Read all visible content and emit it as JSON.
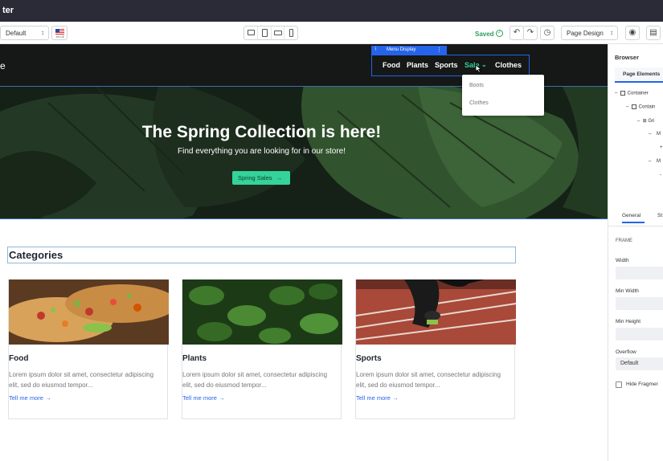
{
  "app": {
    "title_fragment": "ter"
  },
  "toolbar": {
    "segment_select": "Default",
    "language_label": "en-US",
    "saved_label": "Saved",
    "page_design_select": "Page Design"
  },
  "site": {
    "logo_fragment": "e",
    "menu_display_label": "Menu Display",
    "menu": [
      "Food",
      "Plants",
      "Sports",
      "Sale",
      "Clothes"
    ],
    "sale_color": "#34d399",
    "dropdown": [
      "Boots",
      "Clothes"
    ],
    "hero": {
      "title": "The Spring Collection is here!",
      "subtitle": "Find everything you are looking for in our store!",
      "button": "Spring Sales"
    },
    "categories_heading": "Categories",
    "cards": [
      {
        "title": "Food",
        "text": "Lorem ipsum dolor sit amet, consectetur adipiscing elit, sed do eiusmod tempor...",
        "link": "Tell me more"
      },
      {
        "title": "Plants",
        "text": "Lorem ipsum dolor sit amet, consectetur adipiscing elit, sed do eiusmod tempor...",
        "link": "Tell me more"
      },
      {
        "title": "Sports",
        "text": "Lorem ipsum dolor sit amet, consectetur adipiscing elit, sed do eiusmod tempor...",
        "link": "Tell me more"
      }
    ]
  },
  "panel": {
    "title": "Browser",
    "tab": "Page Elements",
    "tree": [
      "Container",
      "Contain",
      "Gri",
      "M",
      "+",
      "M",
      "-"
    ],
    "tabs": [
      "General",
      "St"
    ],
    "section": "FRAME",
    "fields": [
      "Width",
      "Min Width",
      "Min Height",
      "Overflow"
    ],
    "overflow_value": "Default",
    "checkbox_label": "Hide Fragmer"
  },
  "colors": {
    "accent": "#2563eb",
    "nav_bg": "#151816",
    "titlebar": "#2a2b36"
  }
}
